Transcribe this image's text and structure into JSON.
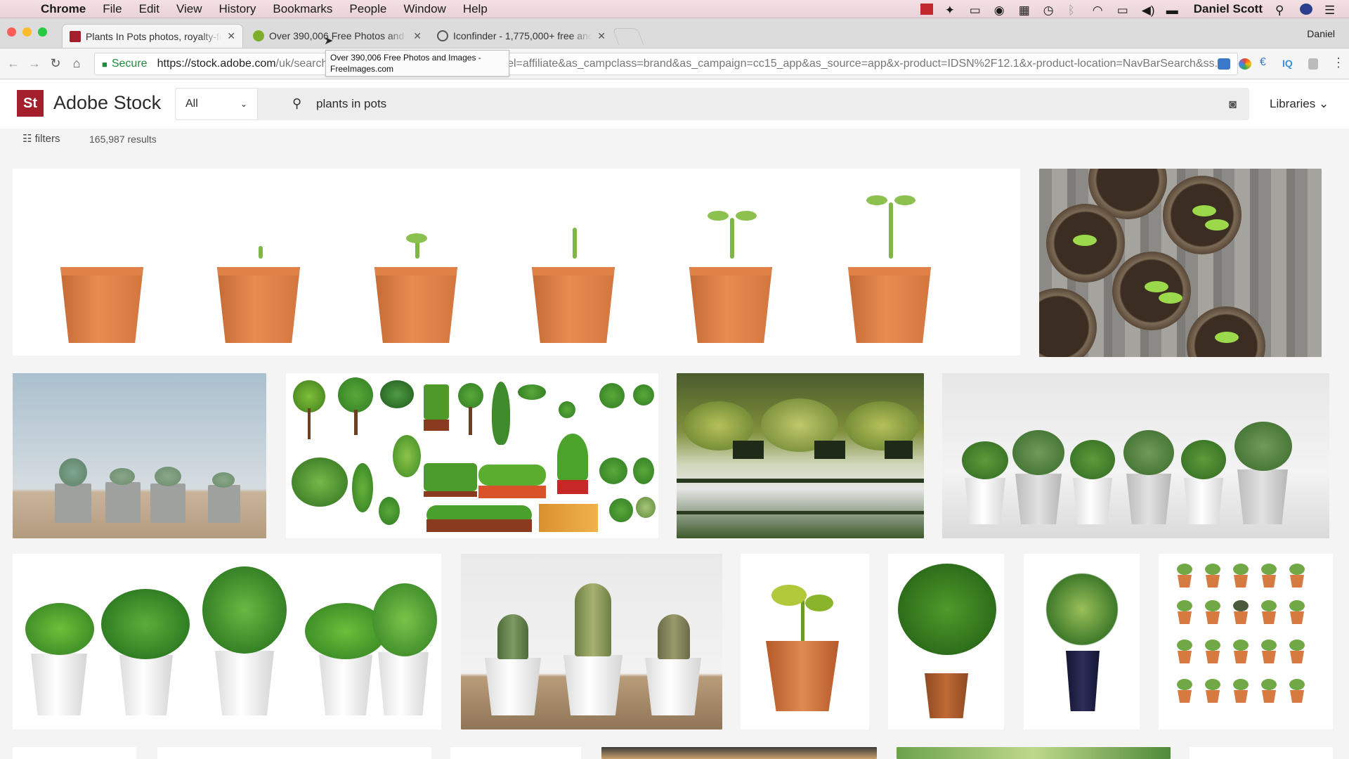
{
  "menubar": {
    "app": "Chrome",
    "items": [
      "File",
      "Edit",
      "View",
      "History",
      "Bookmarks",
      "People",
      "Window",
      "Help"
    ],
    "user": "Daniel Scott"
  },
  "tabs": [
    {
      "title": "Plants In Pots photos, royalty-free images, graphics",
      "color": "#a41f2c"
    },
    {
      "title": "Over 390,006 Free Photos and Images - FreeImages.com",
      "color": "#7fae2c"
    },
    {
      "title": "Iconfinder - 1,775,000+ free and premium icons",
      "color": "#555555"
    }
  ],
  "profile_name": "Daniel",
  "omnibox": {
    "secure_label": "Secure",
    "url_host": "https://stock.adobe.com",
    "url_rest": "/uk/search?k=plants%20in%20pots&as_channel=affiliate&as_campclass=brand&as_campaign=cc15_app&as_source=app&x-product=IDSN%2F12.1&x-product-location=NavBarSearch&ss..."
  },
  "tooltip": "Over 390,006 Free Photos and Images - FreeImages.com",
  "adobe": {
    "logo_text": "St",
    "brand": "Adobe Stock",
    "filter_select": "All",
    "query": "plants in pots",
    "libraries": "Libraries",
    "filters_label": "filters",
    "results_count": "165,987 results",
    "brand_color": "#a41f2c"
  }
}
